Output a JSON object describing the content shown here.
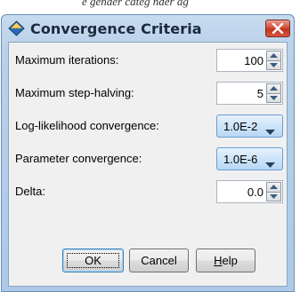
{
  "background": {
    "fragment_text": "e gender categ    nder ag"
  },
  "dialog": {
    "title": "Convergence Criteria",
    "title_icon": "diamond-node-icon",
    "close_icon": "close-icon",
    "fields": [
      {
        "label": "Maximum iterations:",
        "type": "spinner",
        "value": "100"
      },
      {
        "label": "Maximum step-halving:",
        "type": "spinner",
        "value": "5"
      },
      {
        "label": "Log-likelihood convergence:",
        "type": "combo",
        "value": "1.0E-2"
      },
      {
        "label": "Parameter convergence:",
        "type": "combo",
        "value": "1.0E-6"
      },
      {
        "label": "Delta:",
        "type": "spinner",
        "value": "0.0"
      }
    ],
    "buttons": {
      "ok": "OK",
      "cancel": "Cancel",
      "help_mnemonic": "H",
      "help_rest": "elp"
    }
  },
  "colors": {
    "frame": "#b9d1ea",
    "close": "#c7432c",
    "combo": "#cde4f9",
    "icon_orange": "#f7a021",
    "icon_blue": "#2a6ab7"
  }
}
